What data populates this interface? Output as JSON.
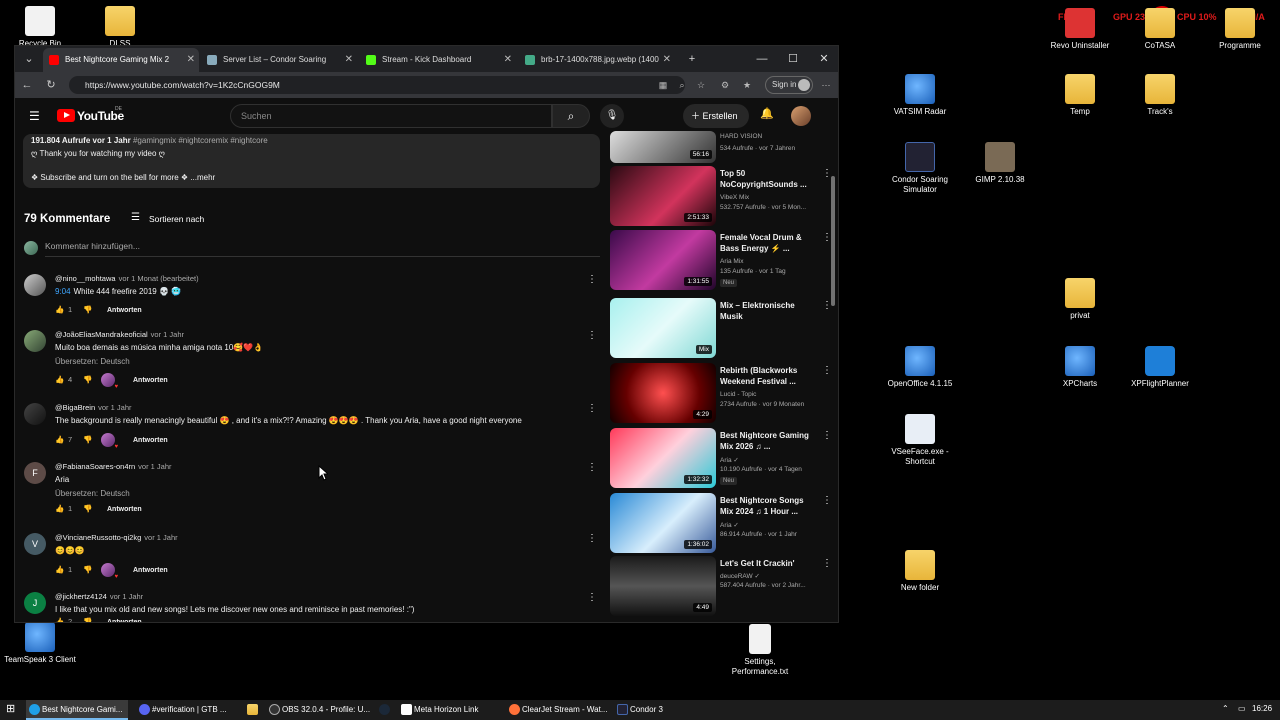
{
  "overlay": {
    "fps": "FPS 0/0",
    "gpu": "GPU 23%",
    "cpu": "CPU 10%",
    "lat": "LAT N/A",
    "badge": "260"
  },
  "desktop_icons": [
    {
      "label": "Recycle Bin",
      "icon": "recycle-bin-icon"
    },
    {
      "label": "DLSS",
      "icon": "folder-icon"
    },
    {
      "label": "Revo Uninstaller",
      "icon": "revo-icon"
    },
    {
      "label": "CoTASA",
      "icon": "folder-icon"
    },
    {
      "label": "Programme",
      "icon": "folder-icon"
    },
    {
      "label": "VATSIM Radar",
      "icon": "vatsim-icon"
    },
    {
      "label": "Temp",
      "icon": "folder-icon"
    },
    {
      "label": "Track's",
      "icon": "folder-icon"
    },
    {
      "label": "Condor Soaring Simulator",
      "icon": "condor-icon"
    },
    {
      "label": "GIMP 2.10.38",
      "icon": "gimp-icon"
    },
    {
      "label": "privat",
      "icon": "folder-icon"
    },
    {
      "label": "OpenOffice 4.1.15",
      "icon": "openoffice-icon"
    },
    {
      "label": "XPCharts",
      "icon": "globe-icon"
    },
    {
      "label": "XPFlightPlanner",
      "icon": "plane-icon"
    },
    {
      "label": "VSeeFace.exe - Shortcut",
      "icon": "vseeface-icon"
    },
    {
      "label": "New folder",
      "icon": "folder-icon"
    },
    {
      "label": "Settings, Performance.txt",
      "icon": "text-file-icon"
    },
    {
      "label": "TeamSpeak 3 Client",
      "icon": "teamspeak-icon"
    }
  ],
  "browser": {
    "tabs": [
      {
        "label": "Best Nightcore Gaming Mix 2",
        "active": true
      },
      {
        "label": "Server List – Condor Soaring"
      },
      {
        "label": "Stream - Kick Dashboard"
      },
      {
        "label": "brb-17-1400x788.jpg.webp (1400"
      }
    ],
    "url": "https://www.youtube.com/watch?v=1K2cCnGOG9M",
    "sign_in": "Sign in"
  },
  "youtube": {
    "logo_text": "YouTube",
    "country": "DE",
    "search_placeholder": "Suchen",
    "create_label": "Erstellen",
    "description": {
      "stats": "191.804 Aufrufe  vor 1 Jahr",
      "tags": "#gamingmix #nightcoremix #nightcore",
      "line2": "ღ Thank you for watching my video ღ",
      "line3": "❖ Subscribe and turn on the bell for more ❖",
      "more": "...mehr"
    },
    "comments_count": "79 Kommentare",
    "sort_label": "Sortieren nach",
    "add_comment_placeholder": "Kommentar hinzufügen...",
    "reply_label": "Antworten",
    "comments": [
      {
        "author": "@nino__mohtawa",
        "time": "vor 1 Monat (bearbeitet)",
        "timestamp": "9:04",
        "text": "White 444 freefire 2019 💀 🥶",
        "likes": "1",
        "heart": false,
        "translate": ""
      },
      {
        "author": "@JoãoEliasMandrakeoficial",
        "time": "vor 1 Jahr",
        "timestamp": "",
        "text": "Muito boa demais as música minha amiga nota 10🥰❤️👌",
        "likes": "4",
        "heart": true,
        "translate": "Übersetzen: Deutsch"
      },
      {
        "author": "@BigaBrein",
        "time": "vor 1 Jahr",
        "timestamp": "",
        "text": "The background is really menacingly beautiful 😍 , and it's a mix?!? Amazing 😍😍😍 . Thank you Aria, have a good night everyone",
        "likes": "7",
        "heart": true,
        "translate": ""
      },
      {
        "author": "@FabianaSoares-on4rn",
        "time": "vor 1 Jahr",
        "timestamp": "",
        "text": "Aria",
        "likes": "1",
        "heart": false,
        "translate": "Übersetzen: Deutsch",
        "initial": "F"
      },
      {
        "author": "@VincianeRussotto-qi2kg",
        "time": "vor 1 Jahr",
        "timestamp": "",
        "text": "😊😊😊",
        "likes": "1",
        "heart": true,
        "translate": "",
        "initial": "V"
      },
      {
        "author": "@jickhertz4124",
        "time": "vor 1 Jahr",
        "timestamp": "",
        "text": "I like that you mix old and new songs! Lets me discover new ones and reminisce in past memories! :\")",
        "likes": "2",
        "heart": false,
        "translate": "",
        "initial": "J"
      }
    ],
    "recommendations": [
      {
        "title": "",
        "channel": "HARD VISION",
        "meta": "534 Aufrufe · vor 7 Jahren",
        "duration": "56:16",
        "neu": ""
      },
      {
        "title": "Top 50 NoCopyrightSounds ...",
        "channel": "VibeX Mix",
        "meta": "532.757 Aufrufe · vor 5 Mon...",
        "duration": "2:51:33",
        "neu": ""
      },
      {
        "title": "Female Vocal Drum & Bass Energy ⚡ ...",
        "channel": "Aria Mix",
        "meta": "135 Aufrufe · vor 1 Tag",
        "duration": "1:31:55",
        "neu": "Neu"
      },
      {
        "title": "Mix – Elektronische Musik",
        "channel": "",
        "meta": "",
        "duration": "Mix",
        "neu": ""
      },
      {
        "title": "Rebirth (Blackworks Weekend Festival ...",
        "channel": "Lucid - Topic",
        "meta": "2734 Aufrufe · vor 9 Monaten",
        "duration": "4:29",
        "neu": ""
      },
      {
        "title": "Best Nightcore Gaming Mix 2026 ♫ ...",
        "channel": "Aria ✓",
        "meta": "10.190 Aufrufe · vor 4 Tagen",
        "duration": "1:32:32",
        "neu": "Neu"
      },
      {
        "title": "Best Nightcore Songs Mix 2024 ♫ 1 Hour ...",
        "channel": "Aria ✓",
        "meta": "86.914 Aufrufe · vor 1 Jahr",
        "duration": "1:36:02",
        "neu": ""
      },
      {
        "title": "Let's Get It Crackin'",
        "channel": "deuceRAW ✓",
        "meta": "587.404 Aufrufe · vor 2 Jahr...",
        "duration": "4:49",
        "neu": ""
      }
    ]
  },
  "taskbar": {
    "items": [
      {
        "label": "Best Nightcore Gami...",
        "active": true
      },
      {
        "label": "#verification | GTB ...",
        "active": false
      },
      {
        "label": "",
        "active": false
      },
      {
        "label": "OBS 32.0.4 - Profile: U...",
        "active": false
      },
      {
        "label": "",
        "active": false
      },
      {
        "label": "Meta Horizon Link",
        "active": false
      },
      {
        "label": "ClearJet Stream - Wat...",
        "active": false
      },
      {
        "label": "Condor 3",
        "active": false
      }
    ],
    "time": "16:26"
  },
  "colors": {
    "yt_bg": "#0f0f0f",
    "accent_red": "#ff0000",
    "link_blue": "#3ea6ff"
  }
}
